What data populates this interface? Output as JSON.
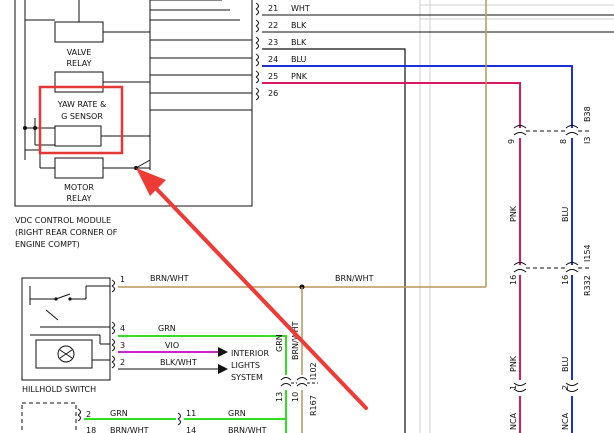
{
  "colors": {
    "wire_black": "#111111",
    "wire_pink": "#d81b60",
    "wire_blue": "#1e2fd8",
    "wire_brown": "#b8965a",
    "wire_green": "#33dd22",
    "wire_violet": "#cc22cc",
    "highlight_red": "#e53935",
    "arrow_red": "#ef3b36"
  },
  "module": {
    "relay_valve": [
      "VALVE",
      "RELAY"
    ],
    "yaw_sensor": [
      "YAW RATE &",
      "G SENSOR"
    ],
    "relay_motor": [
      "MOTOR",
      "RELAY"
    ],
    "caption": [
      "VDC CONTROL MODULE",
      "(RIGHT REAR CORNER OF",
      "ENGINE COMPT)"
    ]
  },
  "module_pins": [
    {
      "pin": "21",
      "color": "WHT"
    },
    {
      "pin": "22",
      "color": "BLK"
    },
    {
      "pin": "23",
      "color": "BLK"
    },
    {
      "pin": "24",
      "color": "BLU"
    },
    {
      "pin": "25",
      "color": "PNK"
    },
    {
      "pin": "26",
      "color": ""
    }
  ],
  "upper_connectors": {
    "pink_pin": "9",
    "blue_pin": "8",
    "ref": [
      "B38",
      "I3"
    ]
  },
  "wire_labels": {
    "pink": "PNK",
    "blue": "BLU",
    "brown": "BRN/WHT",
    "green": "GRN",
    "violet": "VIO",
    "black_white": "BLK/WHT"
  },
  "mid_connectors": {
    "pink_pin": "16",
    "blue_pin": "16",
    "ref_top": "I154",
    "ref_bottom": "R332"
  },
  "hillhold": {
    "title": "HILLHOLD SWITCH",
    "pins": [
      "1",
      "4",
      "3",
      "2"
    ]
  },
  "interior_lights": [
    "INTERIOR",
    "LIGHTS",
    "SYSTEM"
  ],
  "vertical_connector": {
    "pins": [
      "13",
      "10",
      "11"
    ],
    "refs": [
      "R167",
      "I102"
    ]
  },
  "lower_connectors": {
    "pink_pin": "1",
    "blue_pin": "2",
    "pink_ref": "NCA",
    "blue_ref": "NCA"
  },
  "bottom_rows": [
    {
      "left_pin": "2",
      "color": "GRN",
      "mid_pin": "11",
      "right_color": "GRN"
    },
    {
      "left_pin": "18",
      "color": "BRN/WHT",
      "mid_pin": "14",
      "right_color": "BRN/WHT"
    }
  ]
}
